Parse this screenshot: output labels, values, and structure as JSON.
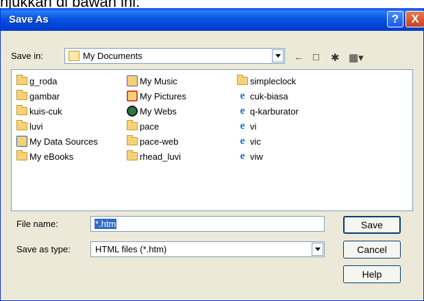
{
  "background_text": "njukkan di bawah ini:",
  "dialog": {
    "title": "Save As",
    "help_button": "?",
    "close_button": "X"
  },
  "save_in": {
    "label": "Save in:",
    "value": "My Documents"
  },
  "files": [
    {
      "name": "g_roda",
      "icon": "folder-icon"
    },
    {
      "name": "gambar",
      "icon": "folder-icon"
    },
    {
      "name": "kuis-cuk",
      "icon": "folder-icon"
    },
    {
      "name": "luvi",
      "icon": "folder-icon"
    },
    {
      "name": "My Data Sources",
      "icon": "data-sources-folder-icon"
    },
    {
      "name": "My eBooks",
      "icon": "folder-icon"
    },
    {
      "name": "My Music",
      "icon": "music-folder-icon"
    },
    {
      "name": "My Pictures",
      "icon": "pictures-folder-icon"
    },
    {
      "name": "My Webs",
      "icon": "webs-folder-icon"
    },
    {
      "name": "pace",
      "icon": "folder-icon"
    },
    {
      "name": "pace-web",
      "icon": "folder-icon"
    },
    {
      "name": "rhead_luvi",
      "icon": "folder-icon"
    },
    {
      "name": "simpleclock",
      "icon": "folder-icon"
    },
    {
      "name": "cuk-biasa",
      "icon": "ie-html-file-icon"
    },
    {
      "name": "q-karburator",
      "icon": "ie-html-file-icon"
    },
    {
      "name": "vi",
      "icon": "ie-html-file-icon"
    },
    {
      "name": "vic",
      "icon": "ie-html-file-icon"
    },
    {
      "name": "viw",
      "icon": "ie-html-file-icon"
    }
  ],
  "file_name": {
    "label": "File name:",
    "value": "*.htm"
  },
  "save_as_type": {
    "label": "Save as type:",
    "value": "HTML files (*.htm)"
  },
  "buttons": {
    "save": "Save",
    "cancel": "Cancel",
    "help": "Help"
  },
  "colors": {
    "titlebar": "#0054e3",
    "dialog_bg": "#ece9d8",
    "selection": "#316ac5"
  }
}
